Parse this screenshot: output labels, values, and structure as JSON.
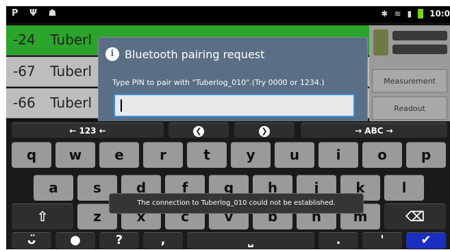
{
  "statusbar": {
    "left_icons": "P Ψ ☗",
    "bluetooth_icon": "✱",
    "wifi_icon": "≋",
    "time": "10:0"
  },
  "devices": [
    {
      "rssi": "-24",
      "name": "Tuberl"
    },
    {
      "rssi": "-67",
      "name": "Tuberl"
    },
    {
      "rssi": "-66",
      "name": "Tuberl"
    }
  ],
  "side": {
    "measurement": "Measurement",
    "readout": "Readout"
  },
  "dialog": {
    "title": "Bluetooth pairing request",
    "info_glyph": "i",
    "message": "Type PIN to pair with \"Tuberlog_010\".(Try 0000 or 1234.)",
    "pin_value": ""
  },
  "keyboard": {
    "toprow": {
      "num_mode": "← 123 ←",
      "left_arrow": "❮",
      "right_arrow": "❯",
      "abc_mode": "→ ABC →"
    },
    "row_q": [
      "q",
      "w",
      "e",
      "r",
      "t",
      "y",
      "u",
      "i",
      "o",
      "p"
    ],
    "row_a": [
      "a",
      "s",
      "d",
      "f",
      "g",
      "h",
      "j",
      "k",
      "l"
    ],
    "row_z": [
      "z",
      "x",
      "c",
      "v",
      "b",
      "n",
      "m"
    ],
    "shift": "⇧",
    "backspace": "⌫",
    "smiley": "ᴗ̈",
    "mic": "🎙",
    "question": "?",
    "comma": ",",
    "period": ".",
    "apostrophe": "'",
    "enter": "✔"
  },
  "toast": {
    "message": "The connection to   Tuberlog_010   could not be established."
  }
}
